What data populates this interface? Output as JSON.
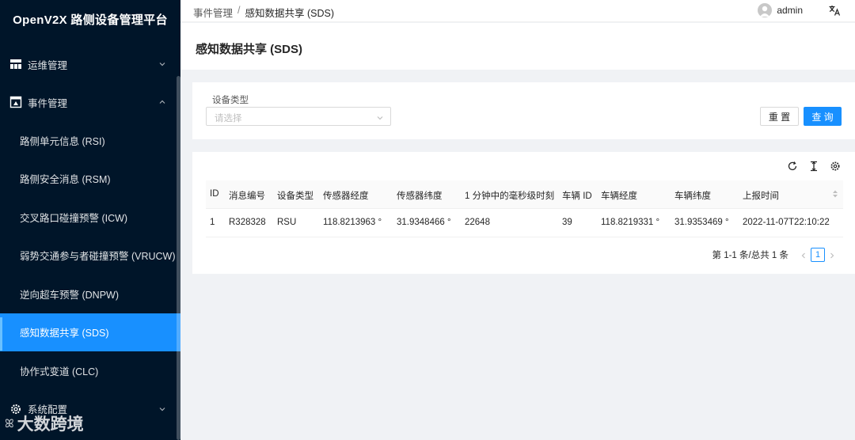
{
  "app": {
    "title": "OpenV2X 路侧设备管理平台"
  },
  "sidebar": {
    "groups": [
      {
        "label": "运维管理",
        "icon": "ops-icon",
        "expanded": false
      },
      {
        "label": "事件管理",
        "icon": "event-icon",
        "expanded": true
      },
      {
        "label": "系统配置",
        "icon": "gear-icon",
        "expanded": false
      }
    ],
    "items": [
      {
        "label": "路侧单元信息 (RSI)"
      },
      {
        "label": "路侧安全消息 (RSM)"
      },
      {
        "label": "交叉路口碰撞预警 (ICW)"
      },
      {
        "label": "弱势交通参与者碰撞预警 (VRUCW)"
      },
      {
        "label": "逆向超车预警 (DNPW)"
      },
      {
        "label": "感知数据共享 (SDS)",
        "active": true
      },
      {
        "label": "协作式变道 (CLC)"
      }
    ]
  },
  "watermark": {
    "text": "大数跨境",
    "mark": "ꕤ"
  },
  "header": {
    "breadcrumb": [
      "事件管理",
      "感知数据共享 (SDS)"
    ],
    "separator": "/",
    "username": "admin"
  },
  "page": {
    "title": "感知数据共享 (SDS)"
  },
  "filter": {
    "device_type_label": "设备类型",
    "device_type_placeholder": "请选择",
    "reset_label": "重 置",
    "query_label": "查 询"
  },
  "table": {
    "columns": [
      "ID",
      "消息编号",
      "设备类型",
      "传感器经度",
      "传感器纬度",
      "1 分钟中的毫秒级时刻",
      "车辆 ID",
      "车辆经度",
      "车辆纬度",
      "上报时间"
    ],
    "rows": [
      [
        "1",
        "R328328",
        "RSU",
        "118.8213963 °",
        "31.9348466 °",
        "22648",
        "39",
        "118.8219331 °",
        "31.9353469 °",
        "2022-11-07T22:10:22"
      ]
    ]
  },
  "pagination": {
    "total_text": "第 1-1 条/总共 1 条",
    "current_page": "1"
  },
  "colors": {
    "sidebar_bg": "#001529",
    "primary": "#1890ff",
    "page_bg": "#f0f2f5"
  }
}
